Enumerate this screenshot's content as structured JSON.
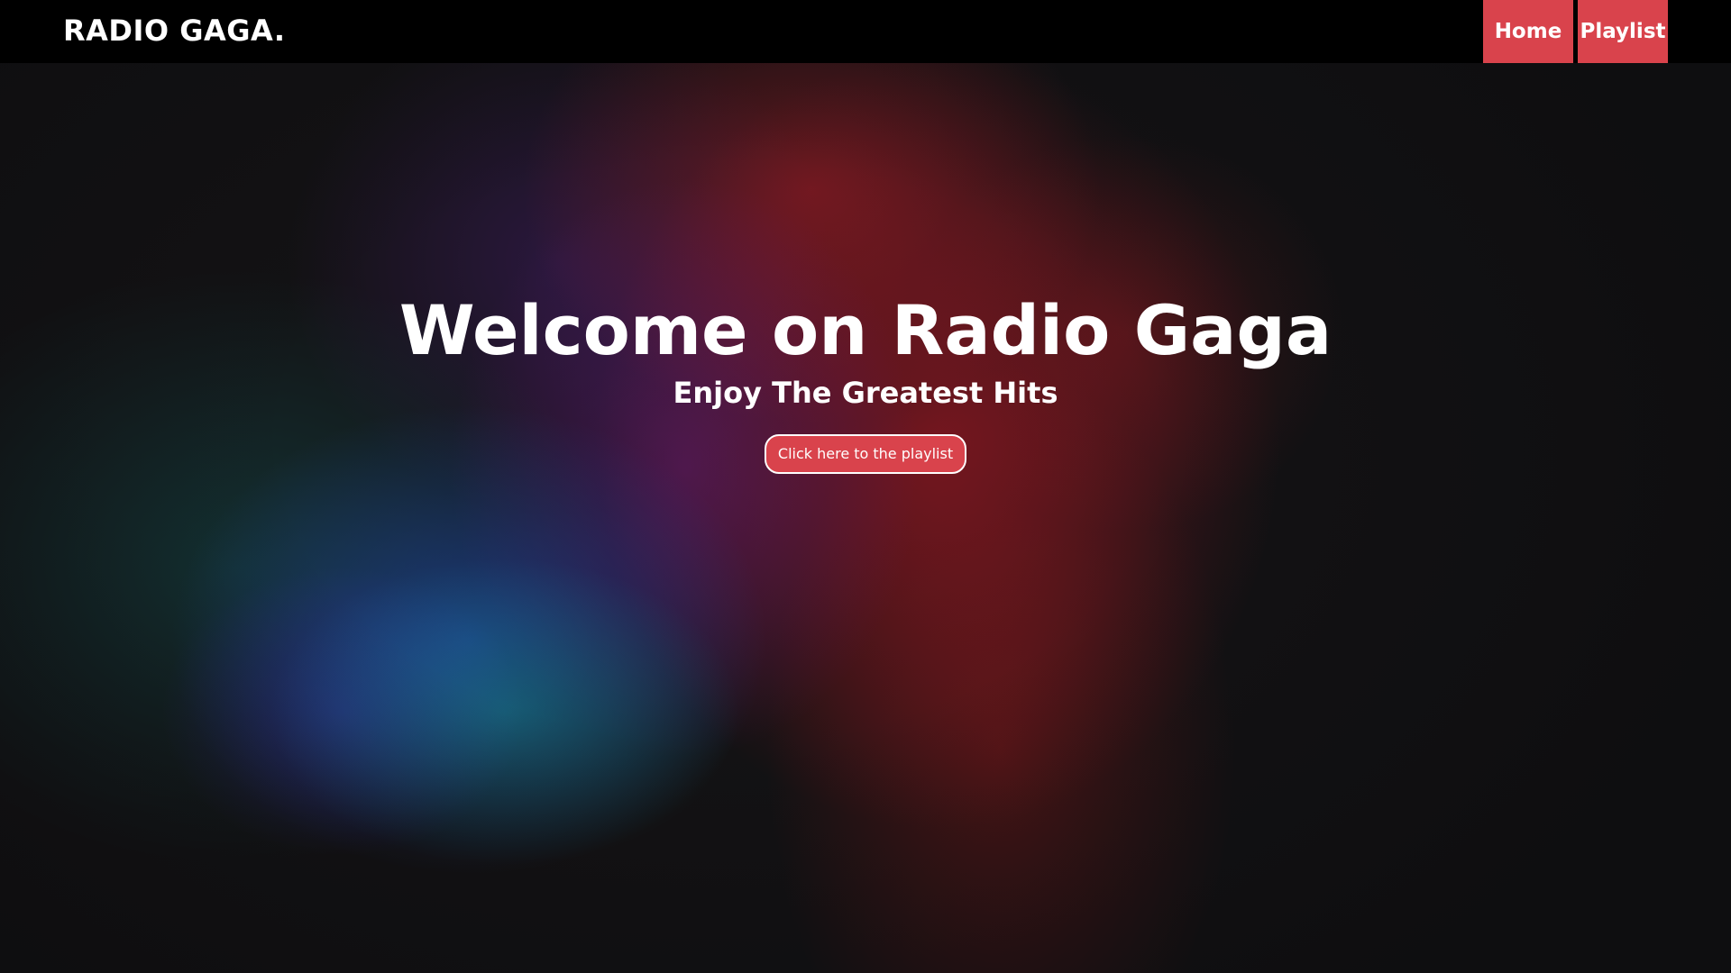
{
  "navbar": {
    "brand": "RADIO GAGA.",
    "links": [
      {
        "label": "Home"
      },
      {
        "label": "Playlist"
      }
    ]
  },
  "hero": {
    "title": "Welcome on Radio Gaga",
    "subtitle": "Enjoy The Greatest Hits",
    "cta_label": "Click here to the playlist"
  },
  "colors": {
    "navbar_bg": "#000000",
    "accent": "#d9434c",
    "text": "#ffffff",
    "page_bg": "#131214"
  }
}
